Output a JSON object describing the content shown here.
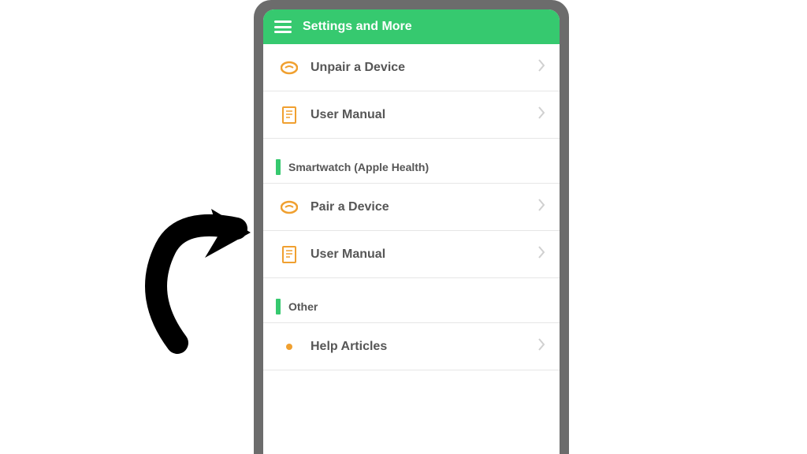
{
  "header": {
    "title": "Settings and More"
  },
  "sections": [
    {
      "items": [
        {
          "label": "Unpair a Device",
          "icon": "link-icon"
        },
        {
          "label": "User Manual",
          "icon": "doc-icon"
        }
      ]
    },
    {
      "title": "Smartwatch (Apple Health)",
      "items": [
        {
          "label": "Pair a Device",
          "icon": "link-icon"
        },
        {
          "label": "User Manual",
          "icon": "doc-icon"
        }
      ]
    },
    {
      "title": "Other",
      "items": [
        {
          "label": "Help Articles",
          "icon": "bullet-icon"
        }
      ]
    }
  ]
}
